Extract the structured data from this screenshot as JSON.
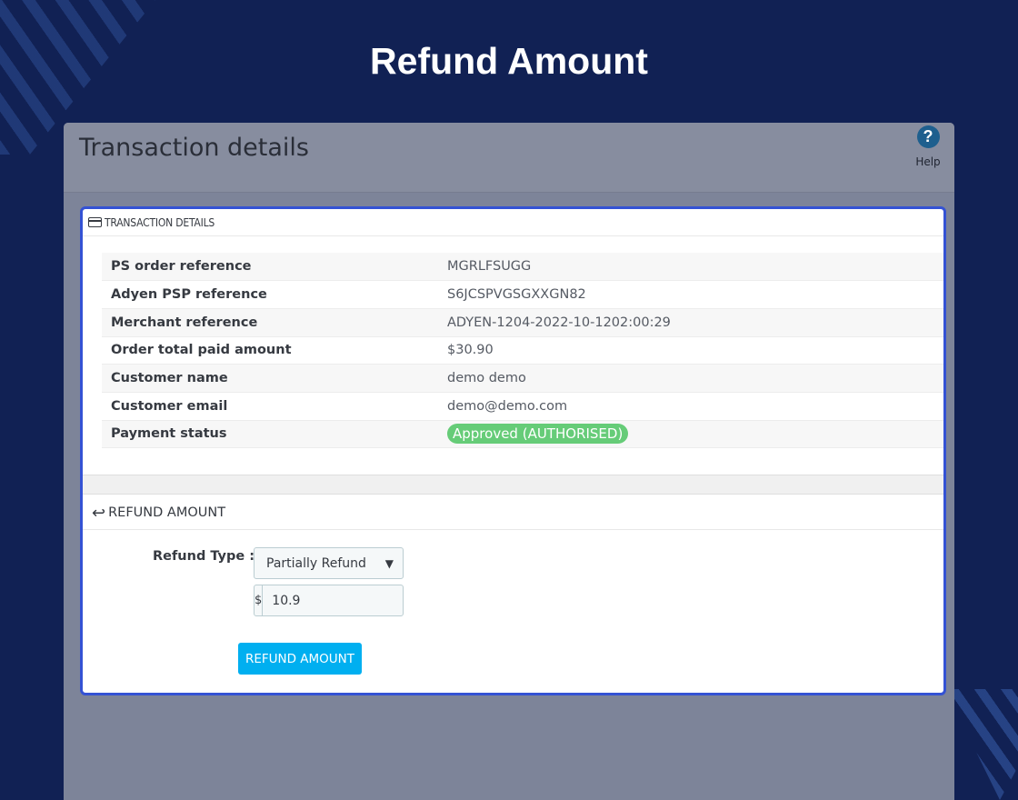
{
  "hero": {
    "title": "Refund Amount"
  },
  "header": {
    "title": "Transaction details",
    "help_label": "Help",
    "help_glyph": "?"
  },
  "transaction": {
    "section_title": "TRANSACTION DETAILS",
    "rows": [
      {
        "label": "PS order reference",
        "value": "MGRLFSUGG"
      },
      {
        "label": "Adyen PSP reference",
        "value": "S6JCSPVGSGXXGN82"
      },
      {
        "label": "Merchant reference",
        "value": "ADYEN-1204-2022-10-1202:00:29"
      },
      {
        "label": "Order total paid amount",
        "value": "$30.90"
      },
      {
        "label": "Customer name",
        "value": "demo demo"
      },
      {
        "label": "Customer email",
        "value": "demo@demo.com"
      },
      {
        "label": "Payment status",
        "value": "Approved (AUTHORISED)"
      }
    ]
  },
  "refund": {
    "section_title": "REFUND AMOUNT",
    "type_label": "Refund Type :",
    "type_selected": "Partially Refund",
    "currency_symbol": "$",
    "amount_value": "10.9",
    "button_label": "REFUND AMOUNT"
  },
  "colors": {
    "background": "#112154",
    "panel_border": "#3452d4",
    "status_badge": "#66cc78",
    "primary_button": "#00aff0",
    "help_icon": "#1e5f8e"
  },
  "icons": {
    "help": "question-circle-icon",
    "transaction_section": "credit-card-icon",
    "refund_section": "reply-arrow-icon",
    "select_caret": "chevron-down-icon"
  }
}
